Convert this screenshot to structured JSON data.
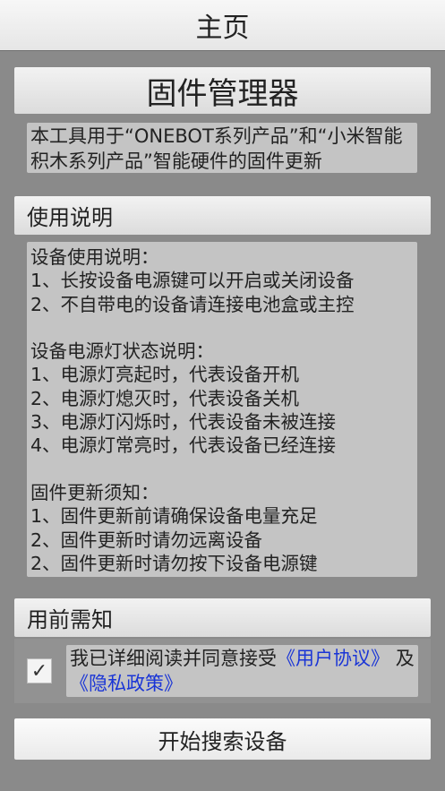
{
  "header": {
    "title": "主页"
  },
  "firmware": {
    "title": "固件管理器",
    "description": "本工具用于“ONEBOT系列产品”和“小米智能积木系列产品”智能硬件的固件更新"
  },
  "usage": {
    "title": "使用说明",
    "lines": [
      "设备使用说明：",
      "1、长按设备电源键可以开启或关闭设备",
      "2、不自带电的设备请连接电池盒或主控",
      "",
      "设备电源灯状态说明：",
      "1、电源灯亮起时，代表设备开机",
      "2、电源灯熄灭时，代表设备关机",
      "3、电源灯闪烁时，代表设备未被连接",
      "4、电源灯常亮时，代表设备已经连接",
      "",
      "固件更新须知：",
      "1、固件更新前请确保设备电量充足",
      "2、固件更新时请勿远离设备",
      "2、固件更新时请勿按下设备电源键"
    ]
  },
  "notice": {
    "title": "用前需知",
    "checked": true,
    "check_mark": "✓",
    "agree_prefix": "我已详细阅读并同意接受",
    "user_agreement_link": "《用户协议》",
    "joiner": "及",
    "privacy_link": "《隐私政策》"
  },
  "actions": {
    "start_search": "开始搜索设备"
  }
}
